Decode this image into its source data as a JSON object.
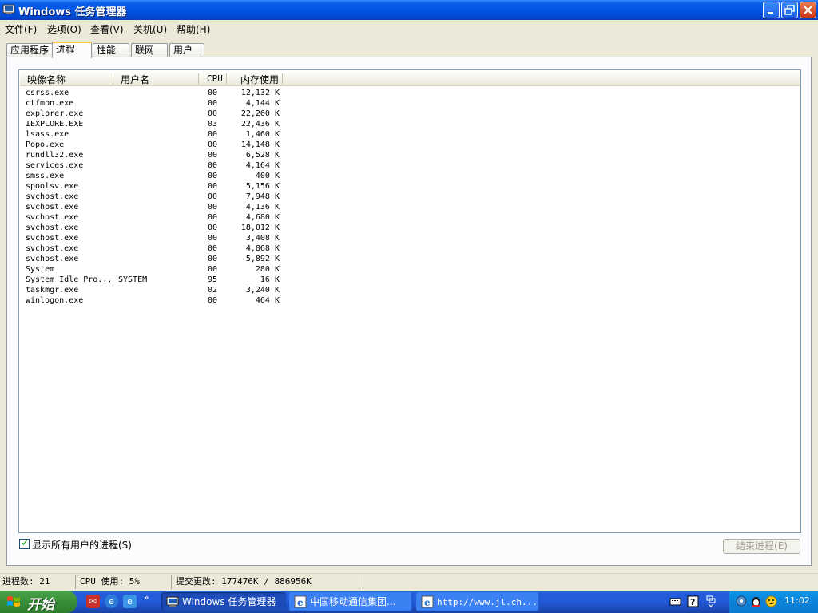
{
  "window": {
    "title": "Windows 任务管理器",
    "buttons": {
      "minimize": "minimize",
      "maximize": "restore",
      "close": "close"
    }
  },
  "menu": [
    "文件(F)",
    "选项(O)",
    "查看(V)",
    "关机(U)",
    "帮助(H)"
  ],
  "tabs": [
    {
      "label": "应用程序",
      "active": false
    },
    {
      "label": "进程",
      "active": true
    },
    {
      "label": "性能",
      "active": false
    },
    {
      "label": "联网",
      "active": false
    },
    {
      "label": "用户",
      "active": false
    }
  ],
  "table": {
    "columns": [
      "映像名称",
      "用户名",
      "CPU",
      "内存使用"
    ],
    "rows": [
      {
        "name": "csrss.exe",
        "user": "",
        "cpu": "00",
        "mem": "12,132 K"
      },
      {
        "name": "ctfmon.exe",
        "user": "",
        "cpu": "00",
        "mem": "4,144 K"
      },
      {
        "name": "explorer.exe",
        "user": "",
        "cpu": "00",
        "mem": "22,260 K"
      },
      {
        "name": "IEXPLORE.EXE",
        "user": "",
        "cpu": "03",
        "mem": "22,436 K"
      },
      {
        "name": "lsass.exe",
        "user": "",
        "cpu": "00",
        "mem": "1,460 K"
      },
      {
        "name": "Popo.exe",
        "user": "",
        "cpu": "00",
        "mem": "14,148 K"
      },
      {
        "name": "rundll32.exe",
        "user": "",
        "cpu": "00",
        "mem": "6,528 K"
      },
      {
        "name": "services.exe",
        "user": "",
        "cpu": "00",
        "mem": "4,164 K"
      },
      {
        "name": "smss.exe",
        "user": "",
        "cpu": "00",
        "mem": "400 K"
      },
      {
        "name": "spoolsv.exe",
        "user": "",
        "cpu": "00",
        "mem": "5,156 K"
      },
      {
        "name": "svchost.exe",
        "user": "",
        "cpu": "00",
        "mem": "7,948 K"
      },
      {
        "name": "svchost.exe",
        "user": "",
        "cpu": "00",
        "mem": "4,136 K"
      },
      {
        "name": "svchost.exe",
        "user": "",
        "cpu": "00",
        "mem": "4,680 K"
      },
      {
        "name": "svchost.exe",
        "user": "",
        "cpu": "00",
        "mem": "18,012 K"
      },
      {
        "name": "svchost.exe",
        "user": "",
        "cpu": "00",
        "mem": "3,408 K"
      },
      {
        "name": "svchost.exe",
        "user": "",
        "cpu": "00",
        "mem": "4,868 K"
      },
      {
        "name": "svchost.exe",
        "user": "",
        "cpu": "00",
        "mem": "5,892 K"
      },
      {
        "name": "System",
        "user": "",
        "cpu": "00",
        "mem": "280 K"
      },
      {
        "name": "System Idle Pro...",
        "user": "SYSTEM",
        "cpu": "95",
        "mem": "16 K"
      },
      {
        "name": "taskmgr.exe",
        "user": "",
        "cpu": "02",
        "mem": "3,240 K"
      },
      {
        "name": "winlogon.exe",
        "user": "",
        "cpu": "00",
        "mem": "464 K"
      }
    ]
  },
  "show_all_users": {
    "label": "显示所有用户的进程(S)",
    "checked": true
  },
  "end_process_label": "结束进程(E)",
  "status": {
    "process_count": "进程数: 21",
    "cpu_usage": "CPU 使用: 5%",
    "commit": "提交更改: 177476K / 886956K"
  },
  "taskbar": {
    "start_label": "开始",
    "tasks": [
      {
        "label": "Windows 任务管理器",
        "active": true
      },
      {
        "label": "中国移动通信集团...",
        "active": false
      },
      {
        "label": "http://www.jl.ch...",
        "active": false
      }
    ],
    "clock": "11:02",
    "chevron": "»"
  },
  "colors": {
    "titlebar": "#0054E3",
    "taskbar": "#245EDC",
    "start": "#388E38",
    "tray": "#0B83D8"
  }
}
